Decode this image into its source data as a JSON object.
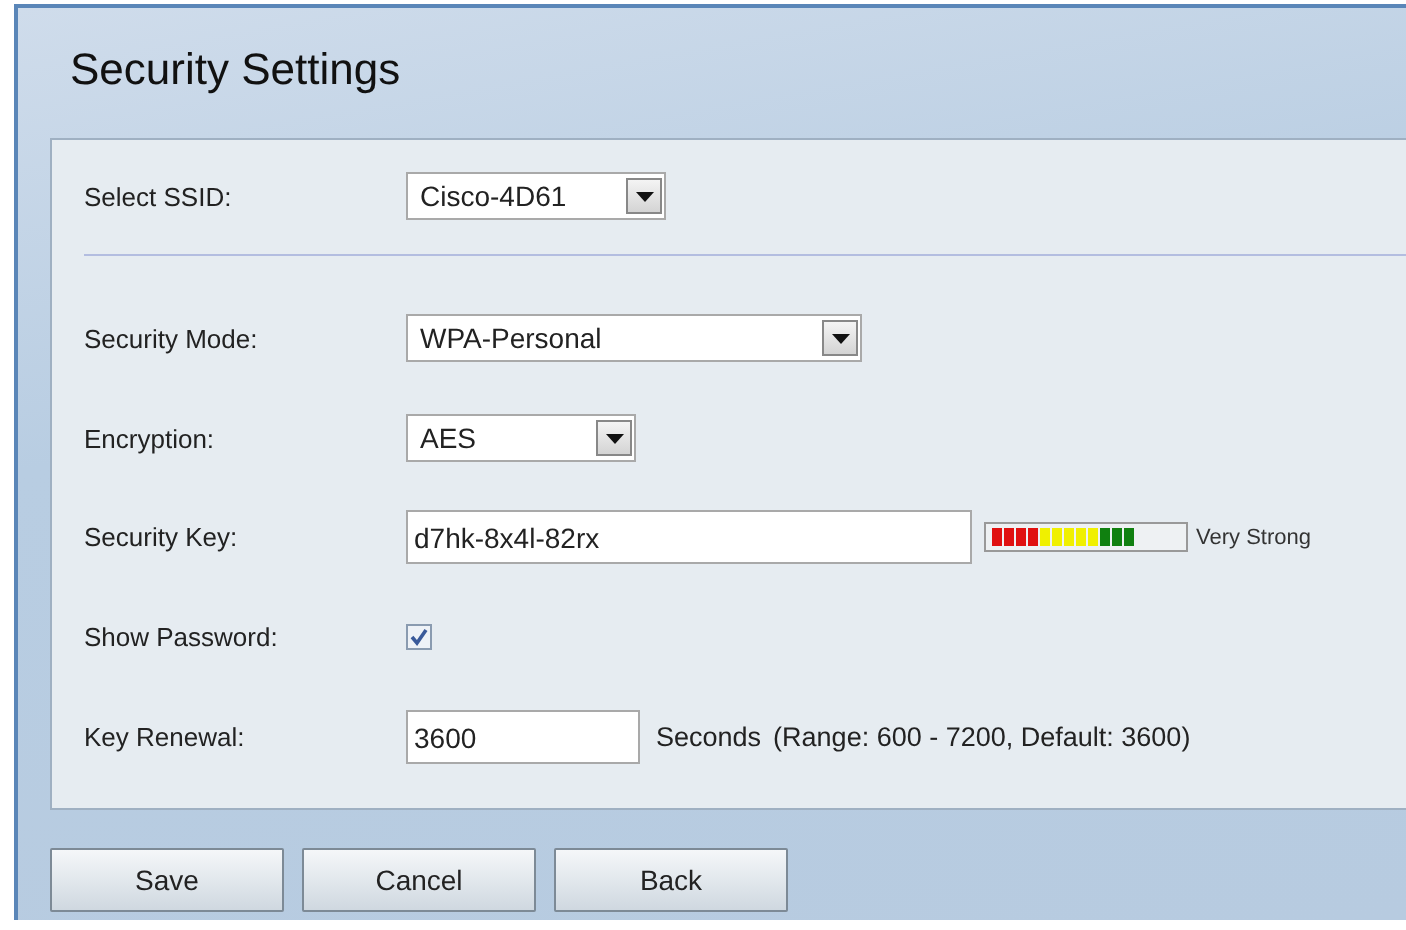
{
  "title": "Security Settings",
  "ssid": {
    "label": "Select SSID:",
    "value": "Cisco-4D61"
  },
  "fields": [
    {
      "kind": "select",
      "label": "Security Mode:",
      "value": "WPA-Personal"
    },
    {
      "kind": "select",
      "label": "Encryption:",
      "value": "AES"
    },
    {
      "kind": "key",
      "label": "Security Key:",
      "value": "d7hk-8x4l-82rx",
      "level": 0.8,
      "strength": "Very Strong"
    },
    {
      "kind": "checkbox",
      "label": "Show Password:",
      "checked": true
    },
    {
      "kind": "number",
      "label": "Key Renewal:",
      "value": "3600",
      "unit": "Seconds",
      "hint": "(Range: 600 - 7200, Default: 3600)"
    }
  ],
  "buttons": [
    "Save",
    "Cancel",
    "Back"
  ]
}
